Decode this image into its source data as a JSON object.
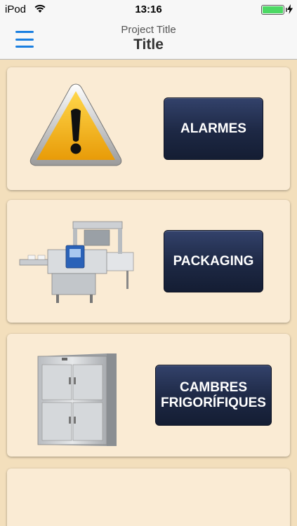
{
  "status_bar": {
    "carrier": "iPod",
    "time": "13:16",
    "battery_level": 1.0
  },
  "nav": {
    "project_title": "Project Title",
    "title": "Title"
  },
  "cards": [
    {
      "button_label": "ALARMES",
      "image": "warning-sign"
    },
    {
      "button_label": "PACKAGING",
      "image": "packaging-machine"
    },
    {
      "button_label": "CAMBRES\nFRIGORÍFIQUES",
      "image": "cold-storage-room"
    }
  ],
  "colors": {
    "background": "#f3dfbc",
    "card": "#faebd4",
    "button": "#1d2844",
    "accent": "#1a7fe0"
  }
}
